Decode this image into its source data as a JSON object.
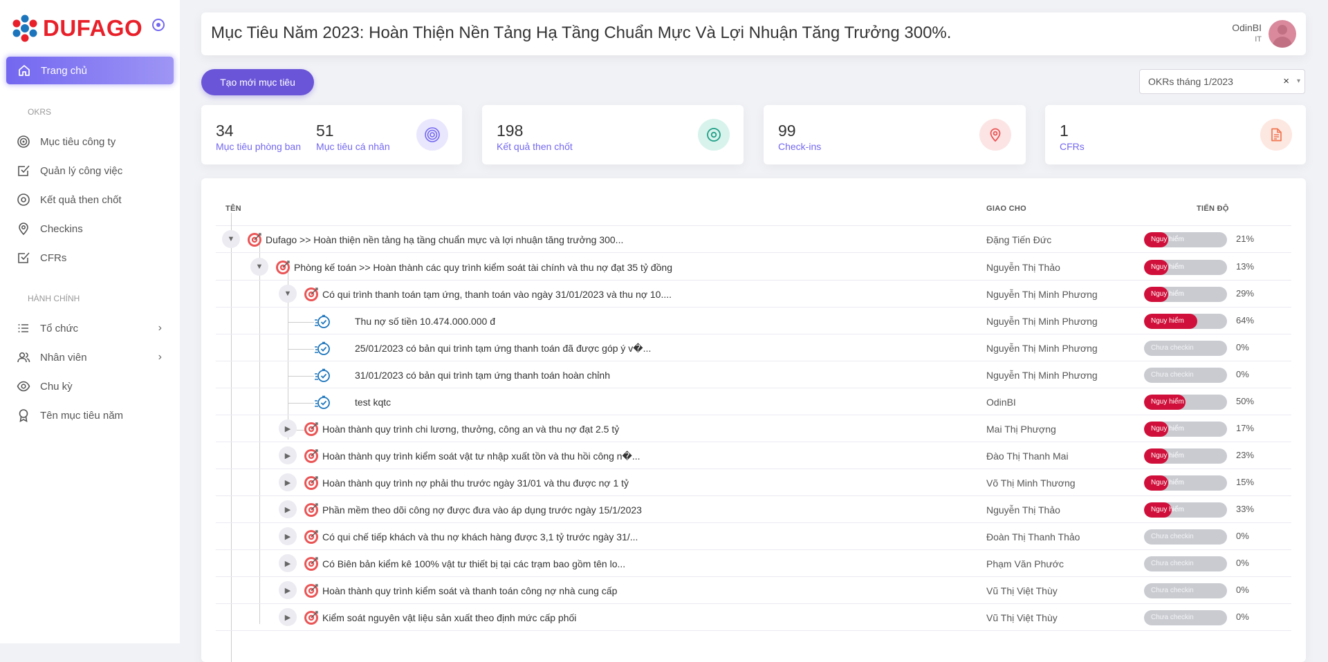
{
  "brand": {
    "name": "DUFAGO"
  },
  "sidebar": {
    "active_item": "Trang chủ",
    "section_okrs": "OKRS",
    "okrs_items": [
      "Mục tiêu công ty",
      "Quản lý công việc",
      "Kết quả then chốt",
      "Checkins",
      "CFRs"
    ],
    "section_admin": "HÀNH CHÍNH",
    "admin_items": [
      "Tổ chức",
      "Nhân viên",
      "Chu kỳ",
      "Tên mục tiêu năm"
    ]
  },
  "header": {
    "title": "Mục Tiêu Năm 2023: Hoàn Thiện Nền Tảng Hạ Tầng Chuẩn Mực Và Lợi Nhuận Tăng Trưởng 300%.",
    "user_name": "OdinBI",
    "user_role": "IT"
  },
  "toolbar": {
    "create_label": "Tạo mới mục tiêu",
    "period_value": "OKRs tháng 1/2023",
    "clear_symbol": "×",
    "arrow_symbol": "▾"
  },
  "stats": {
    "dept_count": "34",
    "dept_label": "Mục tiêu phòng ban",
    "personal_count": "51",
    "personal_label": "Mục tiêu cá nhân",
    "kr_count": "198",
    "kr_label": "Kết quả then chốt",
    "checkin_count": "99",
    "checkin_label": "Check-ins",
    "cfr_count": "1",
    "cfr_label": "CFRs"
  },
  "table": {
    "col_name": "TÊN",
    "col_owner": "GIAO CHO",
    "col_progress": "TIẾN ĐỘ",
    "rows": [
      {
        "name": "Dufago >> Hoàn thiện nền tảng hạ tầng chuẩn mực và lợi nhuận tăng trưởng 300...",
        "owner": "Đặng Tiến Đức",
        "status": "Nguy hiểm",
        "progress": 21,
        "progress_text": "21%"
      },
      {
        "name": "Phòng kế toán >> Hoàn thành các quy trình kiểm soát tài chính và thu nợ đạt 35 tỷ đồng",
        "owner": "Nguyễn Thị Thảo",
        "status": "Nguy hiểm",
        "progress": 13,
        "progress_text": "13%"
      },
      {
        "name": "Có qui trình thanh toán tạm ứng, thanh toán vào ngày 31/01/2023 và thu nợ 10....",
        "owner": "Nguyễn Thị Minh Phương",
        "status": "Nguy hiểm",
        "progress": 29,
        "progress_text": "29%"
      },
      {
        "name": "Thu nợ số tiền 10.474.000.000 đ",
        "owner": "Nguyễn Thị Minh Phương",
        "status": "Nguy hiểm",
        "progress": 64,
        "progress_text": "64%"
      },
      {
        "name": "25/01/2023 có bản qui trình tạm ứng thanh toán đã được góp ý v�...",
        "owner": "Nguyễn Thị Minh Phương",
        "status": "Chưa checkin",
        "progress": 0,
        "progress_text": "0%"
      },
      {
        "name": "31/01/2023 có bản qui trình tạm ứng thanh toán hoàn chỉnh",
        "owner": "Nguyễn Thị Minh Phương",
        "status": "Chưa checkin",
        "progress": 0,
        "progress_text": "0%"
      },
      {
        "name": "test kqtc",
        "owner": "OdinBI",
        "status": "Nguy hiểm",
        "progress": 50,
        "progress_text": "50%"
      },
      {
        "name": "Hoàn thành quy trình chi lương, thưởng, công an và thu nợ đạt 2.5 tỷ",
        "owner": "Mai Thị Phượng",
        "status": "Nguy hiểm",
        "progress": 17,
        "progress_text": "17%"
      },
      {
        "name": "Hoàn thành quy trình kiểm soát vật tư nhập xuất tồn và thu hồi công n�...",
        "owner": "Đào Thị Thanh Mai",
        "status": "Nguy hiểm",
        "progress": 23,
        "progress_text": "23%"
      },
      {
        "name": "Hoàn thành quy trình nợ phải thu trước ngày 31/01 và thu được nợ 1 tỷ",
        "owner": "Võ Thị Minh Thương",
        "status": "Nguy hiểm",
        "progress": 15,
        "progress_text": "15%"
      },
      {
        "name": "Phần mềm theo dõi công nợ được đưa vào áp dụng trước ngày 15/1/2023",
        "owner": "Nguyễn Thị Thảo",
        "status": "Nguy hiểm",
        "progress": 33,
        "progress_text": "33%"
      },
      {
        "name": "Có qui chế tiếp khách và thu nợ khách hàng được 3,1 tỷ trước ngày 31/...",
        "owner": "Đoàn Thị Thanh Thảo",
        "status": "Chưa checkin",
        "progress": 0,
        "progress_text": "0%"
      },
      {
        "name": "Có Biên bản kiểm kê 100% vật tư thiết bị tại các trạm bao gồm tên lo...",
        "owner": "Phạm Văn Phước",
        "status": "Chưa checkin",
        "progress": 0,
        "progress_text": "0%"
      },
      {
        "name": "Hoàn thành quy trình kiểm soát và thanh toán công nợ nhà cung cấp",
        "owner": "Vũ Thị Việt Thùy",
        "status": "Chưa checkin",
        "progress": 0,
        "progress_text": "0%"
      },
      {
        "name": "Kiểm soát nguyên vật liệu sản xuất theo định mức cấp phối",
        "owner": "Vũ Thị Việt Thùy",
        "status": "Chưa checkin",
        "progress": 0,
        "progress_text": "0%"
      }
    ]
  },
  "colors": {
    "accent": "#7367f0",
    "danger": "#d0103a",
    "neutral_bar": "#c9cbd1",
    "brand_red": "#e8202a",
    "brand_blue": "#1c75bc"
  }
}
